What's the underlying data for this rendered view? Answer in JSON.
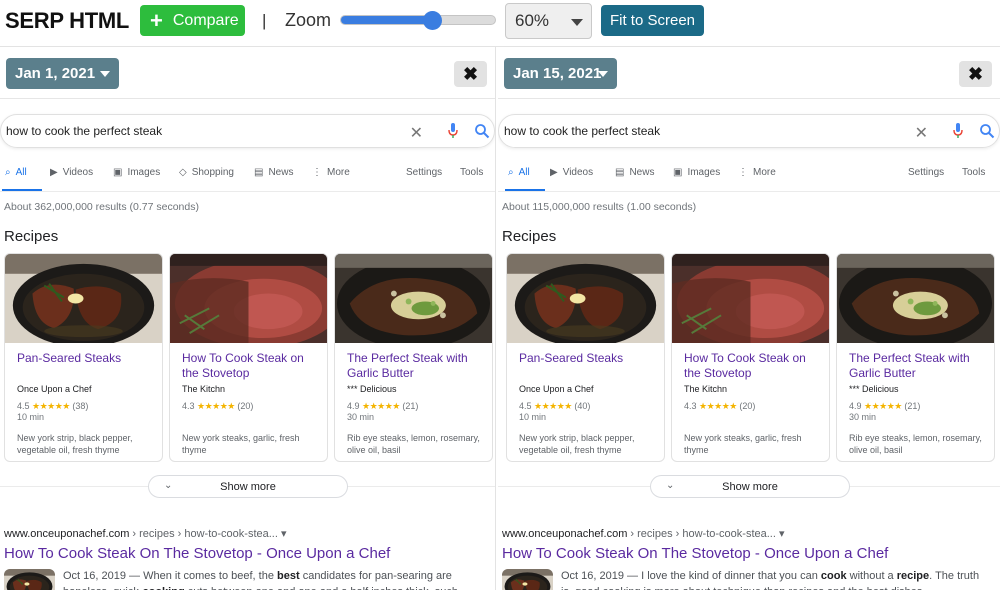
{
  "toolbar": {
    "app_title": "SERP HTML",
    "compare_label": "Compare",
    "separator": "|",
    "zoom_label": "Zoom",
    "zoom_slider_level": 0.6,
    "zoom_value": "60%",
    "fit_label": "Fit to Screen"
  },
  "colors": {
    "compare_green": "#2dbd3d",
    "fit_blue": "#1b6a87",
    "date_slate": "#5b7f8c",
    "visited_link": "#5a2aa0",
    "active_tab": "#1a73e8",
    "star": "#f4b400"
  },
  "left": {
    "date": "Jan 1, 2021",
    "close_icon": "close-icon",
    "query": "how to cook the perfect steak",
    "tabs": [
      "All",
      "Videos",
      "Images",
      "Shopping",
      "News",
      "More"
    ],
    "tools": [
      "Settings",
      "Tools"
    ],
    "stats": "About 362,000,000 results (0.77 seconds)",
    "section_title": "Recipes",
    "cards": [
      {
        "title": "Pan-Seared Steaks",
        "source": "Once Upon a Chef",
        "rating": "4.5",
        "stars": "★★★★★",
        "reviews": "(38)",
        "time": "10 min",
        "ingredients": "New york strip, black pepper, vegetable oil, fresh thyme"
      },
      {
        "title": "How To Cook Steak on the Stovetop",
        "source": "The Kitchn",
        "rating": "4.3",
        "stars": "★★★★★",
        "reviews": "(20)",
        "time": "",
        "ingredients": "New york steaks, garlic, fresh thyme"
      },
      {
        "title": "The Perfect Steak with Garlic Butter",
        "source": "*** Delicious",
        "rating": "4.9",
        "stars": "★★★★★",
        "reviews": "(21)",
        "time": "30 min",
        "ingredients": "Rib eye steaks, lemon, rosemary, olive oil, basil"
      }
    ],
    "show_more": "Show more",
    "result": {
      "domain": "www.onceuponachef.com",
      "path": " › recipes › how-to-cook-stea... ▾",
      "title": "How To Cook Steak On The Stovetop - Once Upon a Chef",
      "date": "Oct 16, 2019",
      "snippet_a": " — When it comes to beef, the ",
      "snippet_b1": "best",
      "snippet_c": " candidates for pan-searing are boneless, quick-",
      "snippet_d1": "cooking",
      "snippet_e": " cuts between one and one and a half inches thick, such"
    }
  },
  "right": {
    "date": "Jan 15, 2021",
    "close_icon": "close-icon",
    "query": "how to cook the perfect steak",
    "tabs": [
      "All",
      "Videos",
      "News",
      "Images",
      "More"
    ],
    "tools": [
      "Settings",
      "Tools"
    ],
    "stats": "About 115,000,000 results (1.00 seconds)",
    "section_title": "Recipes",
    "cards": [
      {
        "title": "Pan-Seared Steaks",
        "source": "Once Upon a Chef",
        "rating": "4.5",
        "stars": "★★★★★",
        "reviews": "(40)",
        "time": "10 min",
        "ingredients": "New york strip, black pepper, vegetable oil, fresh thyme"
      },
      {
        "title": "How To Cook Steak on the Stovetop",
        "source": "The Kitchn",
        "rating": "4.3",
        "stars": "★★★★★",
        "reviews": "(20)",
        "time": "",
        "ingredients": "New york steaks, garlic, fresh thyme"
      },
      {
        "title": "The Perfect Steak with Garlic Butter",
        "source": "*** Delicious",
        "rating": "4.9",
        "stars": "★★★★★",
        "reviews": "(21)",
        "time": "30 min",
        "ingredients": "Rib eye steaks, lemon, rosemary, olive oil, basil"
      }
    ],
    "show_more": "Show more",
    "result": {
      "domain": "www.onceuponachef.com",
      "path": " › recipes › how-to-cook-stea... ▾",
      "title": "How To Cook Steak On The Stovetop - Once Upon a Chef",
      "date": "Oct 16, 2019",
      "snippet_a": " — I love the kind of dinner that you can ",
      "snippet_b1": "cook",
      "snippet_c": " without a ",
      "snippet_d1": "recipe",
      "snippet_e": ". The truth is, good cooking is more about technique than recipes and the best dishes"
    }
  }
}
